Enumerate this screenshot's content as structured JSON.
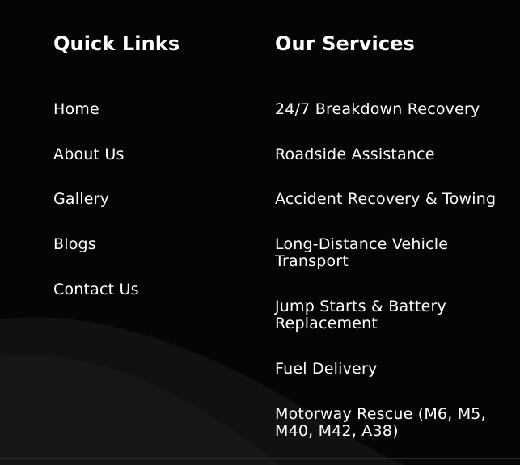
{
  "quick_links": {
    "heading": "Quick Links",
    "items": [
      {
        "label": "Home"
      },
      {
        "label": "About Us"
      },
      {
        "label": "Gallery"
      },
      {
        "label": "Blogs"
      },
      {
        "label": "Contact Us"
      }
    ]
  },
  "services": {
    "heading": "Our Services",
    "items": [
      {
        "label": "24/7 Breakdown Recovery"
      },
      {
        "label": "Roadside Assistance"
      },
      {
        "label": "Accident Recovery & Towing"
      },
      {
        "label": "Long-Distance Vehicle Transport"
      },
      {
        "label": "Jump Starts & Battery Replacement"
      },
      {
        "label": "Fuel Delivery"
      },
      {
        "label": "Motorway Rescue (M6, M5, M40, M42, A38)"
      }
    ]
  },
  "colors": {
    "background": "#050505",
    "text": "#ffffff"
  }
}
